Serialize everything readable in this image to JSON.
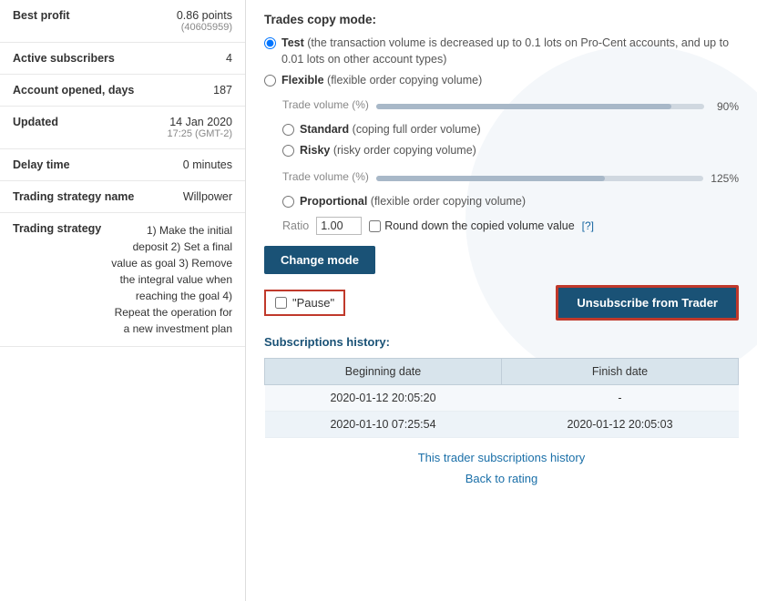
{
  "left": {
    "rows": [
      {
        "label": "Best profit",
        "value": "0.86 points",
        "subValue": "(40605959)"
      },
      {
        "label": "Active subscribers",
        "value": "4",
        "subValue": null
      },
      {
        "label": "Account opened, days",
        "value": "187",
        "subValue": null
      },
      {
        "label": "Updated",
        "value": "14 Jan 2020",
        "subValue": "17:25 (GMT-2)"
      },
      {
        "label": "Delay time",
        "value": "0 minutes",
        "subValue": null
      },
      {
        "label": "Trading strategy name",
        "value": "Willpower",
        "subValue": null
      }
    ],
    "trading_strategy_label": "Trading strategy",
    "trading_strategy_text": "1) Make the initial deposit 2) Set a final value as goal 3) Remove the integral value when reaching the goal 4) Repeat the operation for a new investment plan"
  },
  "right": {
    "trades_copy_mode_title": "Trades copy mode:",
    "modes": [
      {
        "id": "test",
        "name": "Test",
        "desc": "(the transaction volume is decreased up to 0.1 lots on Pro-Cent accounts, and up to 0.01 lots on other account types)",
        "selected": true
      },
      {
        "id": "flexible",
        "name": "Flexible",
        "desc": "(flexible order copying volume)",
        "selected": false
      }
    ],
    "volume_flexible_percent": "90%",
    "volume_flexible_label": "Trade volume (%)",
    "sub_modes": [
      {
        "id": "standard",
        "name": "Standard",
        "desc": "(coping full order volume)",
        "selected": false
      },
      {
        "id": "risky",
        "name": "Risky",
        "desc": "(risky order copying volume)",
        "selected": false
      }
    ],
    "volume_risky_percent": "125%",
    "volume_risky_label": "Trade volume (%)",
    "sub_modes2": [
      {
        "id": "proportional",
        "name": "Proportional",
        "desc": "(flexible order copying volume)",
        "selected": false
      }
    ],
    "ratio_label": "Ratio",
    "ratio_value": "1.00",
    "round_down_label": "Round down the copied volume value",
    "help_label": "[?]",
    "change_mode_btn": "Change mode",
    "pause_label": "\"Pause\"",
    "unsubscribe_btn": "Unsubscribe from Trader",
    "history_title": "Subscriptions history:",
    "history_columns": [
      "Beginning date",
      "Finish date"
    ],
    "history_rows": [
      {
        "beginning": "2020-01-12 20:05:20",
        "finish": "-"
      },
      {
        "beginning": "2020-01-10 07:25:54",
        "finish": "2020-01-12 20:05:03"
      }
    ],
    "footer_link1": "This trader subscriptions history",
    "footer_link2": "Back to rating"
  }
}
